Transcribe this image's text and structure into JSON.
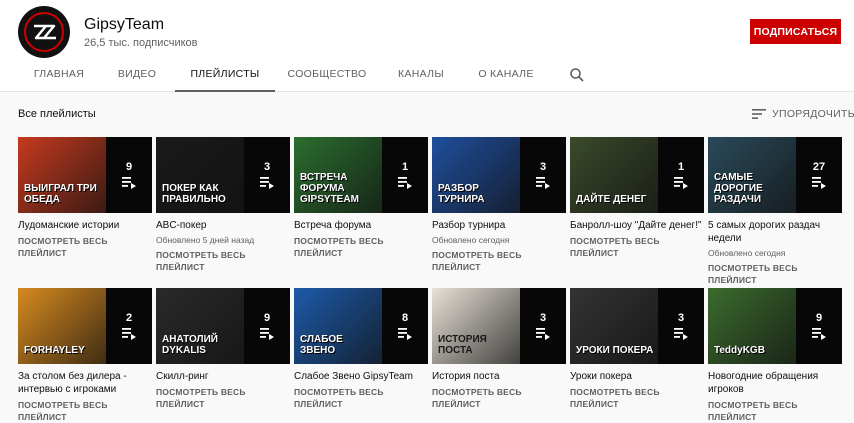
{
  "channel": {
    "name": "GipsyTeam",
    "subscribers": "26,5 тыс. подписчиков",
    "subscribe_label": "ПОДПИСАТЬСЯ",
    "brand_color": "#cc0000"
  },
  "tabs": [
    {
      "label": "ГЛАВНАЯ"
    },
    {
      "label": "ВИДЕО"
    },
    {
      "label": "ПЛЕЙЛИСТЫ",
      "active": true
    },
    {
      "label": "СООБЩЕСТВО"
    },
    {
      "label": "КАНАЛЫ"
    },
    {
      "label": "О КАНАЛЕ"
    }
  ],
  "search_icon": "search-icon",
  "section": {
    "title": "Все плейлисты",
    "sort_label": "УПОРЯДОЧИТЬ"
  },
  "playlists": [
    {
      "title": "Лудоманские истории",
      "count": "9",
      "meta": "",
      "link": "ПОСМОТРЕТЬ ВЕСЬ ПЛЕЙЛИСТ",
      "bg": "#c53a1e",
      "art": "ВЫИГРАЛ ТРИ ОБЕДА"
    },
    {
      "title": "ABC-покер",
      "count": "3",
      "meta": "Обновлено 5 дней назад",
      "link": "ПОСМОТРЕТЬ ВЕСЬ ПЛЕЙЛИСТ",
      "bg": "#1a1a1a",
      "art": "ПОКЕР КАК ПРАВИЛЬНО"
    },
    {
      "title": "Встреча форума",
      "count": "1",
      "meta": "",
      "link": "ПОСМОТРЕТЬ ВЕСЬ ПЛЕЙЛИСТ",
      "bg": "#2b6e2f",
      "art": "ВСТРЕЧА ФОРУМА GIPSYTEAM"
    },
    {
      "title": "Разбор турнира",
      "count": "3",
      "meta": "Обновлено сегодня",
      "link": "ПОСМОТРЕТЬ ВЕСЬ ПЛЕЙЛИСТ",
      "bg": "#1f4f9e",
      "art": "РАЗБОР ТУРНИРА"
    },
    {
      "title": "Банролл-шоу \"Дайте денег!\"",
      "count": "1",
      "meta": "",
      "link": "ПОСМОТРЕТЬ ВЕСЬ ПЛЕЙЛИСТ",
      "bg": "#3a4a2a",
      "art": "ДАЙТЕ ДЕНЕГ"
    },
    {
      "title": "5 самых дорогих раздач недели",
      "count": "27",
      "meta": "Обновлено сегодня",
      "link": "ПОСМОТРЕТЬ ВЕСЬ ПЛЕЙЛИСТ",
      "bg": "#2a4a5a",
      "art": "САМЫЕ ДОРОГИЕ РАЗДАЧИ"
    },
    {
      "title": "За столом без дилера - интервью с игроками",
      "count": "2",
      "meta": "",
      "link": "ПОСМОТРЕТЬ ВЕСЬ ПЛЕЙЛИСТ",
      "bg": "#d78a1f",
      "art": "FORHAYLEY"
    },
    {
      "title": "Скилл-ринг",
      "count": "9",
      "meta": "",
      "link": "ПОСМОТРЕТЬ ВЕСЬ ПЛЕЙЛИСТ",
      "bg": "#2a2a2a",
      "art": "АНАТОЛИЙ DYKALIS"
    },
    {
      "title": "Слабое Звено GipsyTeam",
      "count": "8",
      "meta": "",
      "link": "ПОСМОТРЕТЬ ВЕСЬ ПЛЕЙЛИСТ",
      "bg": "#1d5aa8",
      "art": "СЛАБОЕ ЗВЕНО"
    },
    {
      "title": "История поста",
      "count": "3",
      "meta": "",
      "link": "ПОСМОТРЕТЬ ВЕСЬ ПЛЕЙЛИСТ",
      "bg": "#e8e2d8",
      "art": "ИСТОРИЯ ПОСТА"
    },
    {
      "title": "Уроки покера",
      "count": "3",
      "meta": "",
      "link": "ПОСМОТРЕТЬ ВЕСЬ ПЛЕЙЛИСТ",
      "bg": "#333",
      "art": "УРОКИ ПОКЕРА"
    },
    {
      "title": "Новогодние обращения игроков",
      "count": "9",
      "meta": "",
      "link": "ПОСМОТРЕТЬ ВЕСЬ ПЛЕЙЛИСТ",
      "bg": "#3b6b2e",
      "art": "TeddyKGB"
    }
  ]
}
